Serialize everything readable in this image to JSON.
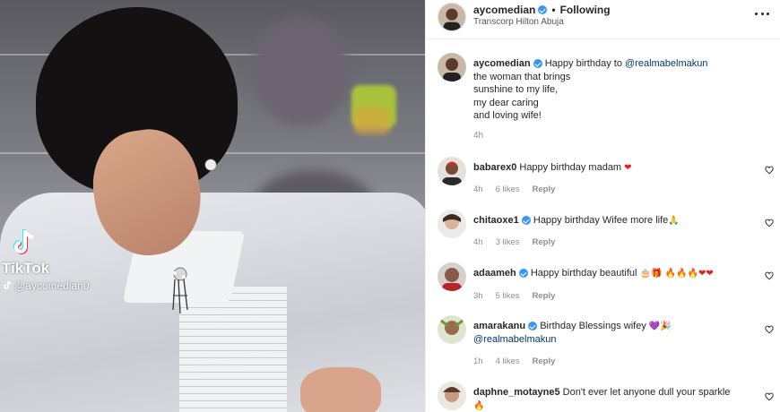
{
  "post": {
    "username": "aycomedian",
    "separator": "•",
    "follow_state": "Following",
    "location": "Transcorp Hilton Abuja"
  },
  "media": {
    "watermark_brand": "TikTok",
    "watermark_handle": "@aycomedian0"
  },
  "caption": {
    "username": "aycomedian",
    "text_prefix": "Happy birthday to ",
    "mention": "@realmabelmakun",
    "lines": [
      "the woman that brings",
      "sunshine to my life,",
      "my dear caring",
      "and loving wife!"
    ],
    "time": "4h"
  },
  "comments": [
    {
      "username": "babarex0",
      "text": "Happy birthday madam",
      "emoji": "❤",
      "time": "4h",
      "likes": "6 likes",
      "reply": "Reply"
    },
    {
      "username": "chitaoxe1",
      "text": "Happy birthday Wifee more life",
      "emoji": "🙏",
      "time": "4h",
      "likes": "3 likes",
      "reply": "Reply"
    },
    {
      "username": "adaameh",
      "text": "Happy birthday beautiful",
      "emoji": "🎂🎁 🔥🔥🔥❤❤",
      "time": "3h",
      "likes": "5 likes",
      "reply": "Reply"
    },
    {
      "username": "amarakanu",
      "text": "Birthday Blessings wifey",
      "emoji": "💜🎉",
      "mention": "@realmabelmakun",
      "time": "1h",
      "likes": "4 likes",
      "reply": "Reply"
    },
    {
      "username": "daphne_motayne5",
      "text": "Don't ever let anyone dull your sparkle",
      "emoji": "🔥",
      "emoji_line2": "💜💜🙈"
    }
  ],
  "colors": {
    "verified": "#3897f0",
    "mention": "#00376b",
    "meta": "#8e8e8e",
    "text": "#262626"
  }
}
